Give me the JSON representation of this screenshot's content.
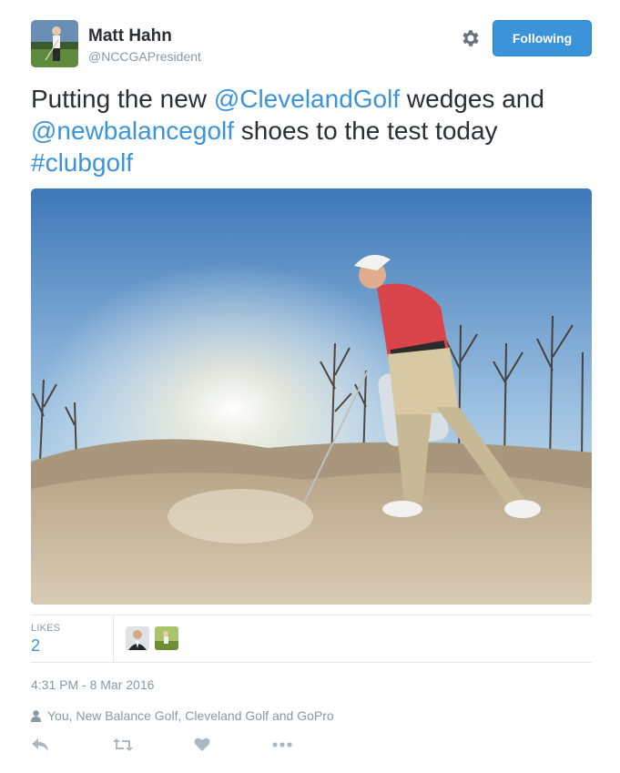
{
  "author": {
    "name": "Matt Hahn",
    "handle": "@NCCGAPresident",
    "follow_label": "Following"
  },
  "tweet": {
    "text_1": "Putting the new ",
    "mention_1": "@ClevelandGolf",
    "text_2": " wedges and ",
    "mention_2": "@newbalancegolf",
    "text_3": " shoes to the test today ",
    "hashtag": "#clubgolf"
  },
  "stats": {
    "likes_label": "LIKES",
    "likes_count": "2"
  },
  "timestamp": "4:31 PM - 8 Mar 2016",
  "social_context": "You, New Balance Golf, Cleveland Golf and GoPro",
  "icons": {
    "settings": "gear-icon",
    "person": "person-icon",
    "reply": "reply-icon",
    "retweet": "retweet-icon",
    "like": "heart-icon",
    "more": "more-icon"
  },
  "colors": {
    "link": "#3b94d9",
    "button": "#3b94d9",
    "muted": "#8899a6",
    "text": "#292f33"
  }
}
